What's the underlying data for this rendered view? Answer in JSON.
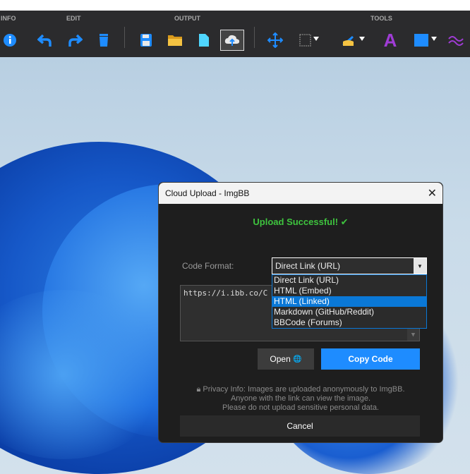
{
  "toolbar": {
    "groups": {
      "info": "INFO",
      "edit": "EDIT",
      "output": "OUTPUT",
      "tools": "TOOLS"
    },
    "buttons": [
      "info-icon",
      "undo-icon",
      "redo-icon",
      "delete-icon",
      "save-icon",
      "open-folder-icon",
      "copy-icon",
      "cloud-upload-icon",
      "move-icon",
      "selection-icon",
      "pen-icon",
      "text-icon",
      "shape-icon",
      "wave-icon"
    ]
  },
  "dialog": {
    "title": "Cloud Upload - ImgBB",
    "status": "Upload Successful!",
    "code_format_label": "Code Format:",
    "selected_format": "Direct Link (URL)",
    "format_options": [
      "Direct Link (URL)",
      "HTML (Embed)",
      "HTML (Linked)",
      "Markdown (GitHub/Reddit)",
      "BBCode (Forums)"
    ],
    "highlighted_option": "HTML (Linked)",
    "code_value": "https://i.ibb.co/C",
    "open_label": "Open",
    "copy_label": "Copy Code",
    "privacy_lines": [
      "Privacy Info: Images are uploaded anonymously to ImgBB.",
      "Anyone with the link can view the image.",
      "Please do not upload sensitive personal data."
    ],
    "cancel_label": "Cancel"
  },
  "colors": {
    "accent": "#1e8cff",
    "success": "#3ec43e",
    "toolbar": "#2b2b2d",
    "dialog": "#1e1e1e"
  }
}
